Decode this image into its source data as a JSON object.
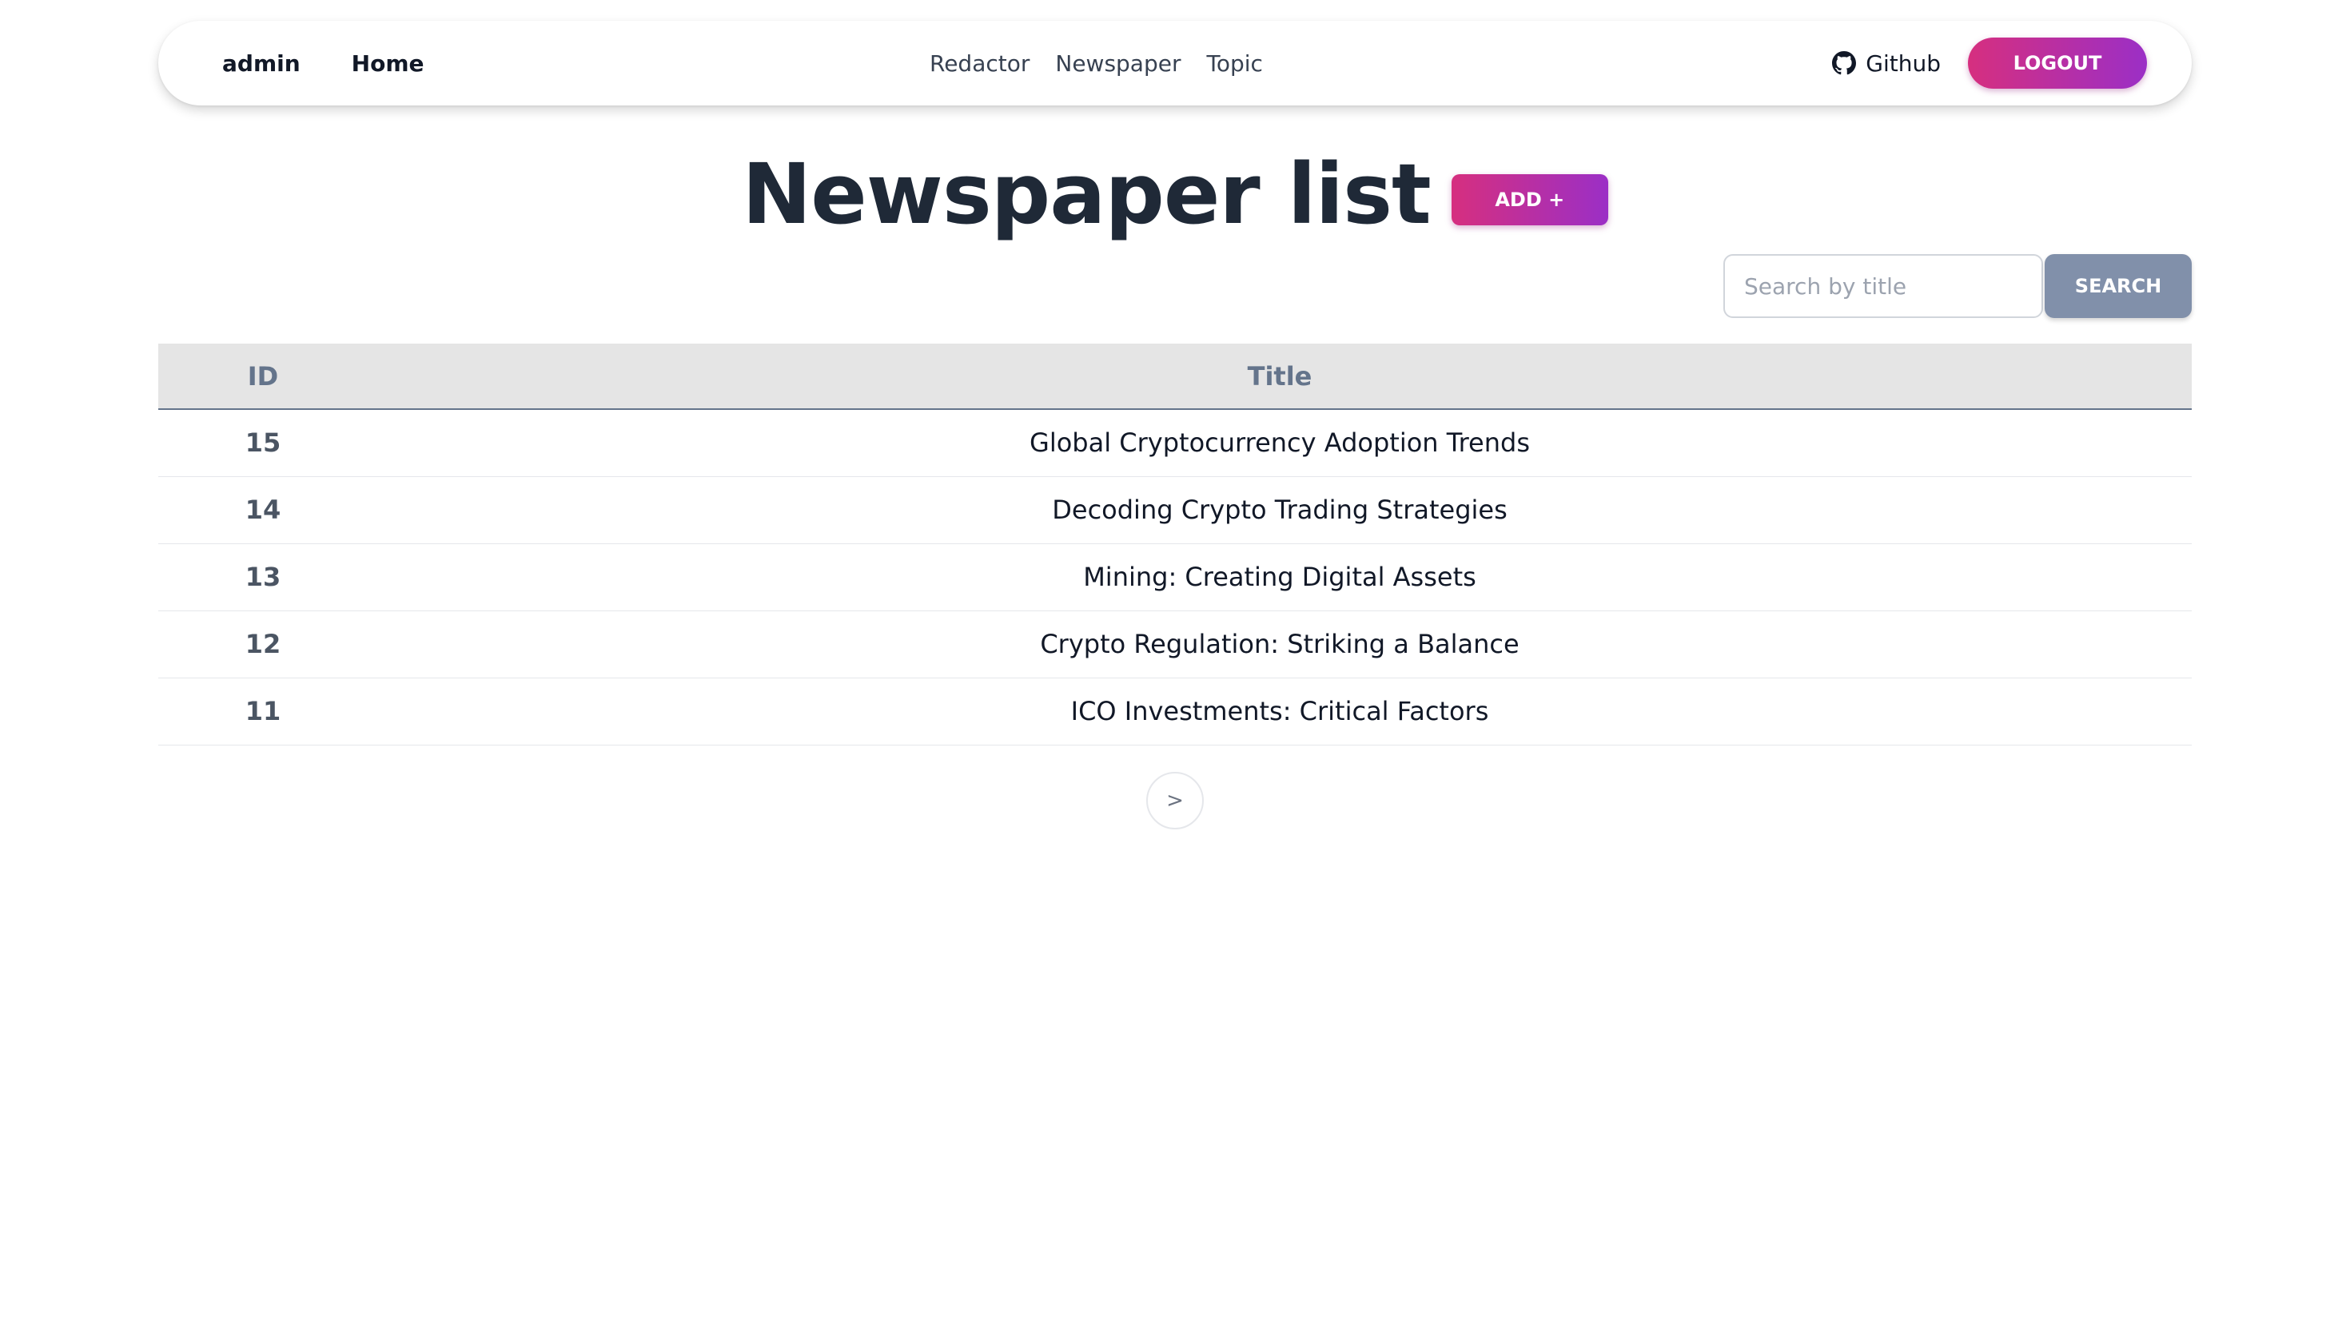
{
  "navbar": {
    "brand": "admin",
    "home": "Home",
    "links": [
      "Redactor",
      "Newspaper",
      "Topic"
    ],
    "github_label": "Github",
    "logout_label": "LOGOUT"
  },
  "header": {
    "title": "Newspaper list",
    "add_label": "ADD +"
  },
  "search": {
    "placeholder": "Search by title",
    "value": "",
    "button_label": "SEARCH"
  },
  "table": {
    "columns": [
      "ID",
      "Title"
    ],
    "rows": [
      {
        "id": "15",
        "title": "Global Cryptocurrency Adoption Trends"
      },
      {
        "id": "14",
        "title": "Decoding Crypto Trading Strategies"
      },
      {
        "id": "13",
        "title": "Mining: Creating Digital Assets"
      },
      {
        "id": "12",
        "title": "Crypto Regulation: Striking a Balance"
      },
      {
        "id": "11",
        "title": "ICO Investments: Critical Factors"
      }
    ]
  },
  "pagination": {
    "next_label": ">"
  },
  "colors": {
    "accent_start": "#d62f7f",
    "accent_end": "#9b2fc6",
    "search_button": "#8190aa"
  },
  "icons": {
    "github": "github-icon"
  }
}
